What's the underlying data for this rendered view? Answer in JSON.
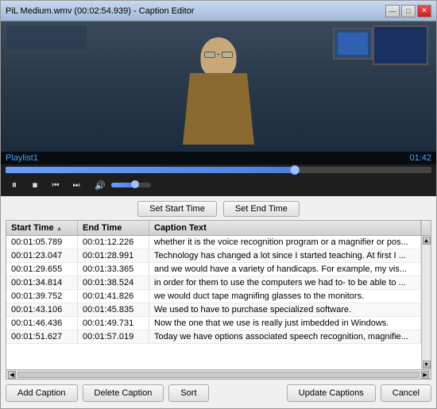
{
  "window": {
    "title": "PiL Medium.wmv (00:02:54.939) - Caption Editor",
    "controls": {
      "minimize": "—",
      "maximize": "□",
      "close": "✕"
    }
  },
  "player": {
    "playlist_label": "Playlist1",
    "time_current": "01:42",
    "progress_percent": 68,
    "volume_percent": 60
  },
  "caption_controls": {
    "set_start_label": "Set Start Time",
    "set_end_label": "Set End Time"
  },
  "table": {
    "columns": [
      "Start Time",
      "End Time",
      "Caption Text"
    ],
    "rows": [
      {
        "start": "00:01:05.789",
        "end": "00:01:12.226",
        "text": "whether it is the voice recognition program or a magnifier or pos..."
      },
      {
        "start": "00:01:23.047",
        "end": "00:01:28.991",
        "text": "Technology has changed a lot since I started teaching. At first I ..."
      },
      {
        "start": "00:01:29.655",
        "end": "00:01:33.365",
        "text": "and we would have a variety of handicaps. For example, my vis..."
      },
      {
        "start": "00:01:34.814",
        "end": "00:01:38.524",
        "text": "in order for them to use the computers we had to- to be able to ..."
      },
      {
        "start": "00:01:39.752",
        "end": "00:01:41.826",
        "text": "we would duct tape magnifing glasses to the monitors."
      },
      {
        "start": "00:01:43.106",
        "end": "00:01:45.835",
        "text": "We used to have to purchase specialized software."
      },
      {
        "start": "00:01:46.436",
        "end": "00:01:49.731",
        "text": "Now the one that we use is really just imbedded in Windows."
      },
      {
        "start": "00:01:51.627",
        "end": "00:01:57.019",
        "text": "Today we have options associated speech recognition, magnifie..."
      }
    ]
  },
  "bottom_buttons": {
    "add_caption": "Add Caption",
    "delete_caption": "Delete Caption",
    "sort": "Sort",
    "update_captions": "Update Captions",
    "cancel": "Cancel"
  }
}
